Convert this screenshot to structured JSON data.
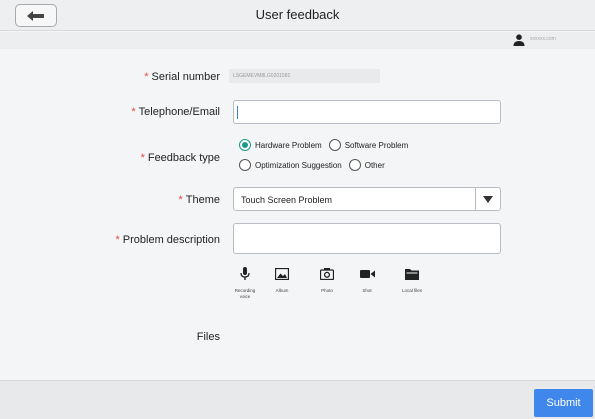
{
  "header": {
    "title": "User feedback",
    "back_icon": "arrow-left-icon"
  },
  "user": {
    "name": "xxxxxx.com",
    "icon": "person-icon"
  },
  "form": {
    "required_mark": "*",
    "serial": {
      "label": "Serial number",
      "value": "LSGEMEVM8LG0201581"
    },
    "contact": {
      "label": "Telephone/Email",
      "value": ""
    },
    "feedback_type": {
      "label": "Feedback type",
      "options": [
        "Hardware Problem",
        "Software Problem",
        "Optimization Suggestion",
        "Other"
      ],
      "selected": "Hardware Problem"
    },
    "theme": {
      "label": "Theme",
      "value": "Touch Screen Problem"
    },
    "description": {
      "label": "Problem description",
      "value": ""
    },
    "files": {
      "label": "Files",
      "buttons": [
        {
          "label": "Recording voice",
          "icon": "microphone-icon"
        },
        {
          "label": "Album",
          "icon": "image-icon"
        },
        {
          "label": "Photo",
          "icon": "camera-icon"
        },
        {
          "label": "Shot",
          "icon": "video-camera-icon"
        },
        {
          "label": "Local files",
          "icon": "folder-icon"
        }
      ]
    }
  },
  "footer": {
    "submit_label": "Submit"
  },
  "colors": {
    "accent": "#3f87ea",
    "radio_selected": "#1e9a8a",
    "required": "#e8473f"
  }
}
